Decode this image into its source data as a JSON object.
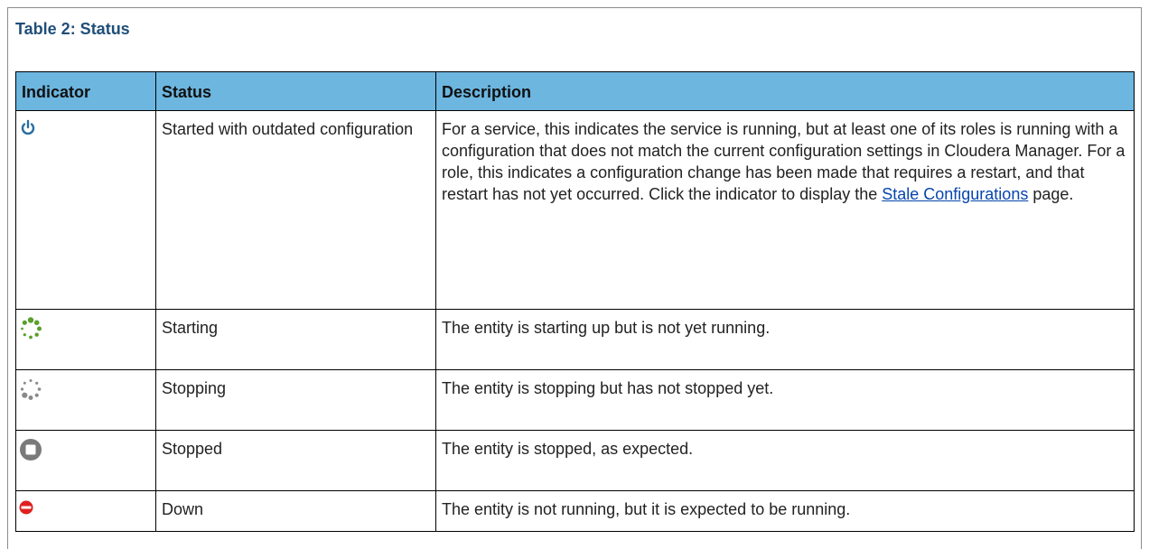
{
  "caption": "Table 2: Status",
  "columns": {
    "indicator": "Indicator",
    "status": "Status",
    "description": "Description"
  },
  "rows": [
    {
      "icon": "outdated-power-icon",
      "status": "Started with outdated configuration",
      "description_before": "For a service, this indicates the service is running, but at least one of its roles is running with a configuration that does not match the current configuration settings in Cloudera Manager. For a role, this indicates a configuration change has been made that requires a restart, and that restart has not yet occurred. Click the indicator to display the ",
      "description_link": "Stale Configurations",
      "description_after": " page."
    },
    {
      "icon": "starting-spinner-icon",
      "status": "Starting",
      "description": "The entity is starting up but is not yet running."
    },
    {
      "icon": "stopping-spinner-icon",
      "status": "Stopping",
      "description": "The entity is stopping but has not stopped yet."
    },
    {
      "icon": "stopped-icon",
      "status": "Stopped",
      "description": "The entity is stopped, as expected."
    },
    {
      "icon": "down-icon",
      "status": "Down",
      "description": "The entity is not running, but it is expected to be running."
    }
  ],
  "colors": {
    "caption": "#1f4e79",
    "header_background": "#6cb6e0",
    "outdated_icon": "#2a6ea0",
    "starting_icon": "#5aa02c",
    "stopping_icon": "#8a8a8a",
    "stopped_icon": "#7a7a7a",
    "down_icon": "#e02020",
    "link": "#0645ad"
  }
}
